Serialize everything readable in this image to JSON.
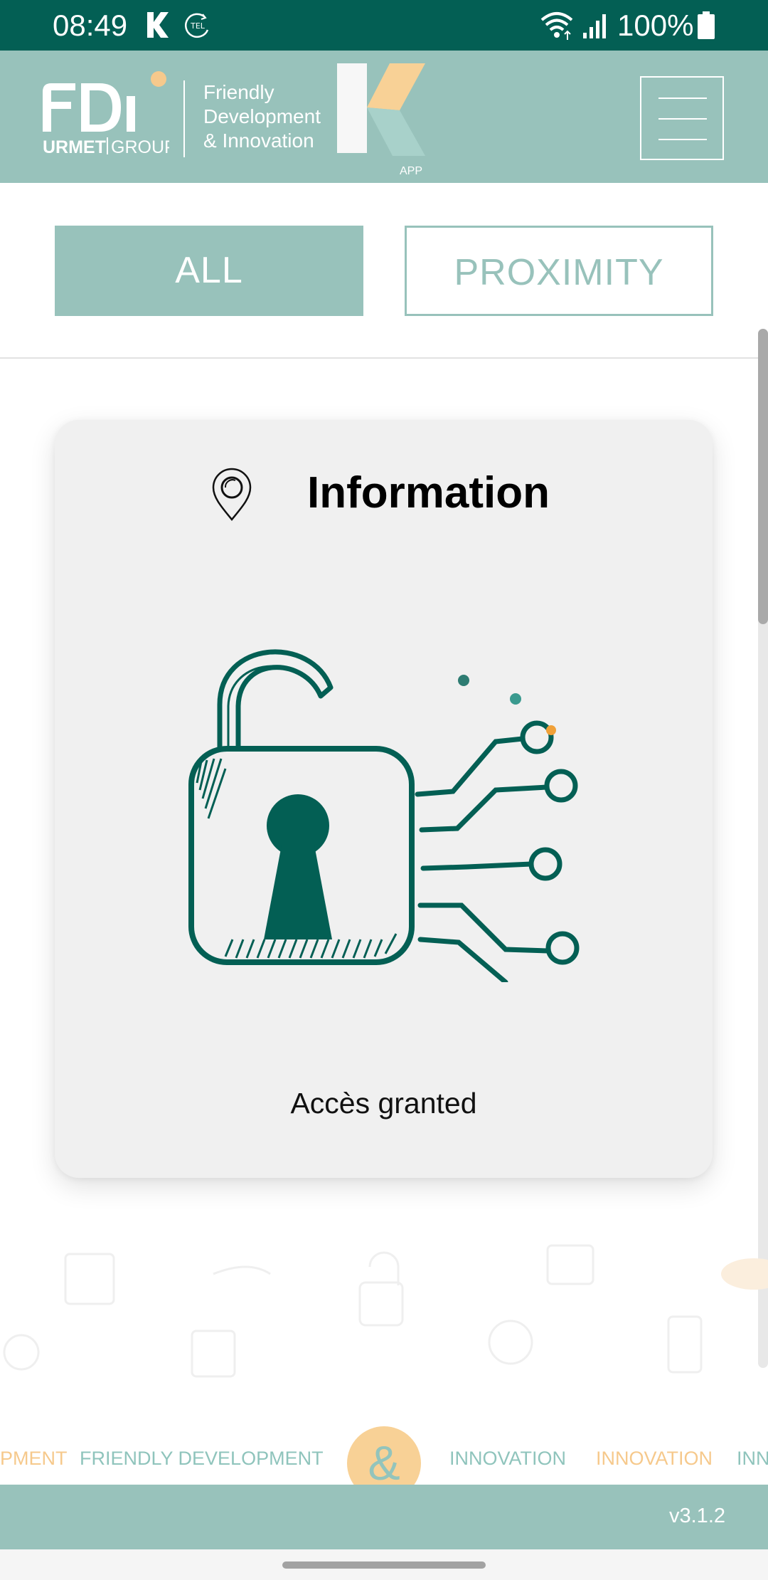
{
  "status_bar": {
    "time": "08:49",
    "battery": "100%",
    "icons": [
      "k-app-icon",
      "tel-icon",
      "wifi-icon",
      "signal-icon",
      "battery-icon"
    ]
  },
  "header": {
    "logo": {
      "brand": "FDi",
      "group": "URMET GROUP"
    },
    "tagline": [
      "Friendly",
      "Development",
      "& Innovation"
    ],
    "app_logo": {
      "letter": "K",
      "sub": "APP"
    },
    "menu_icon": "hamburger-icon"
  },
  "tabs": [
    {
      "label": "ALL",
      "active": true
    },
    {
      "label": "PROXIMITY",
      "active": false
    }
  ],
  "card": {
    "title": "Information",
    "icon": "location-pin-icon",
    "illustration": "unlocked-padlock-circuit-icon",
    "status": "Accès granted"
  },
  "marquee": {
    "items": [
      "PMENT",
      "FRIENDLY DEVELOPMENT",
      "INNOVATION",
      "INNOVATION",
      "INN"
    ],
    "center_symbol": "&"
  },
  "footer": {
    "version": "v3.1.2"
  },
  "colors": {
    "status_bar": "#035f54",
    "header": "#98c2bb",
    "accent_dark": "#035f54",
    "accent_orange": "#f6c98c",
    "card_bg": "#f0f0f0"
  }
}
